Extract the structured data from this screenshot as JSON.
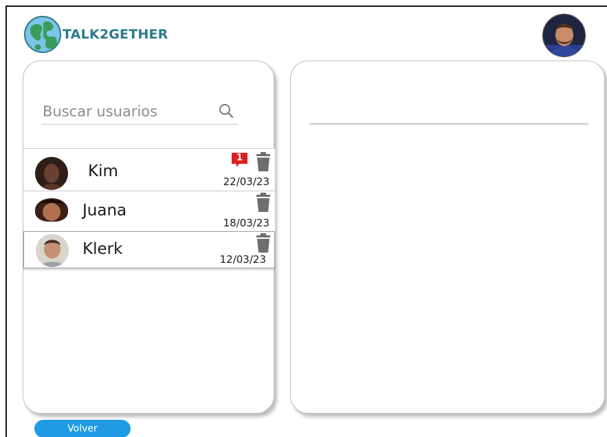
{
  "app": {
    "brand": "TALK2GETHER",
    "logo_icon": "globe-icon",
    "profile_avatar": "user-avatar"
  },
  "search": {
    "placeholder": "Buscar usuarios",
    "value": "",
    "icon": "search-icon"
  },
  "users": [
    {
      "name": "Kim",
      "date": "22/03/23",
      "unread": "1",
      "avatar_color": "#5b3a2e"
    },
    {
      "name": "Juana",
      "date": "18/03/23",
      "avatar_color": "#8a4a2c"
    },
    {
      "name": "Klerk",
      "date": "12/03/23",
      "avatar_color": "#b08a6a"
    }
  ],
  "colors": {
    "brand": "#2b7a8c",
    "badge": "#e02020",
    "button": "#1f9be6",
    "trash": "#6e6e6e"
  },
  "footer": {
    "back_label": "Volver"
  }
}
